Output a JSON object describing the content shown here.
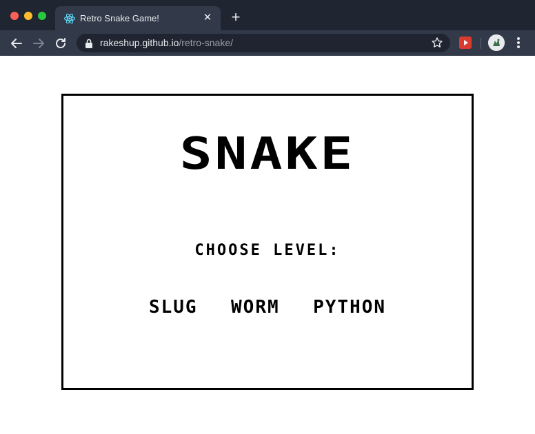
{
  "browser": {
    "tab": {
      "title": "Retro Snake Game!",
      "favicon": "react-atom-icon"
    },
    "url": {
      "host": "rakeshup.github.io",
      "path": "/retro-snake/"
    },
    "colors": {
      "tabstrip": "#1f2531",
      "toolbar": "#323a49",
      "omnibox": "#202430",
      "close": "#fe5f57",
      "minimize": "#febc2e",
      "maximize": "#28c840",
      "extension": "#d93b30"
    }
  },
  "game": {
    "title": "SNAKE",
    "choose_label": "CHOOSE LEVEL:",
    "levels": [
      "SLUG",
      "WORM",
      "PYTHON"
    ]
  }
}
